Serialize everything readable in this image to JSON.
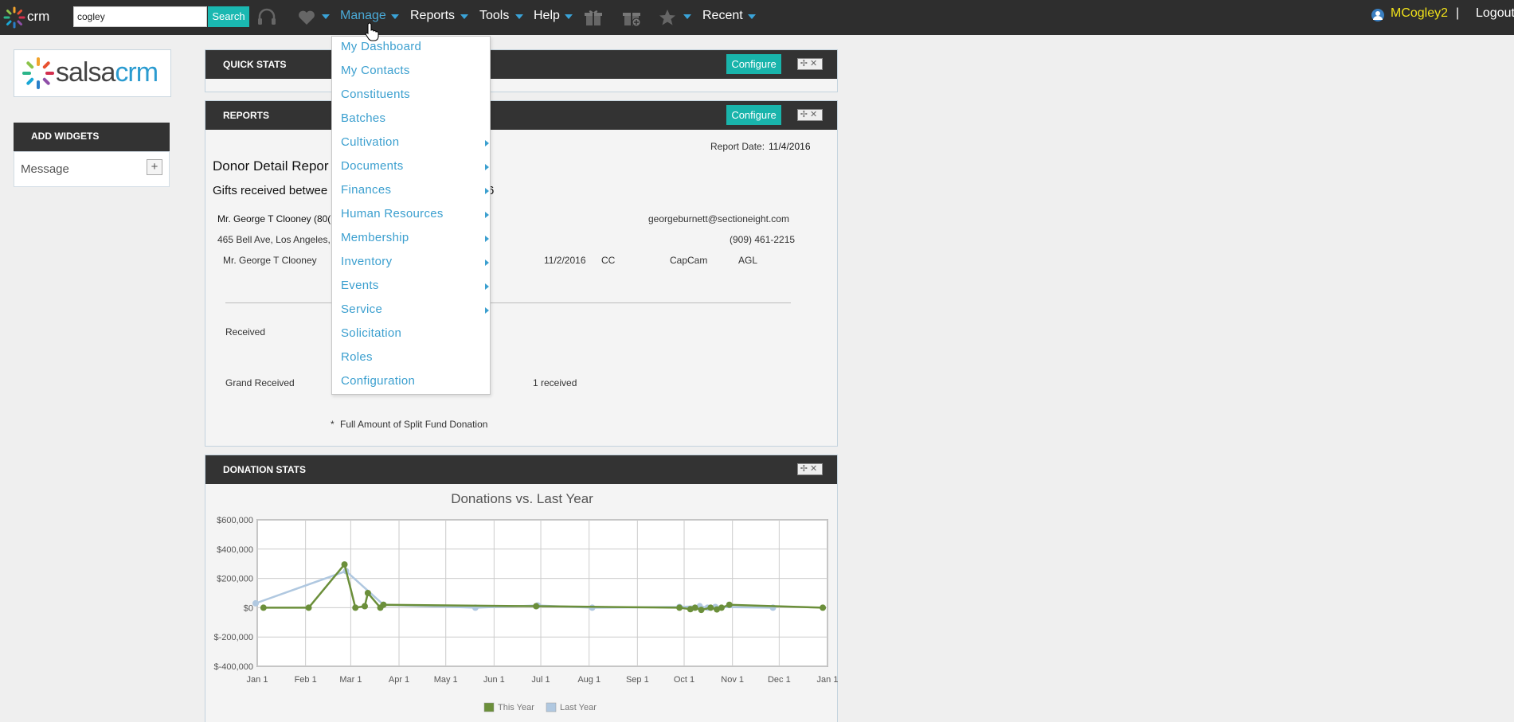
{
  "topbar": {
    "brand": "crm",
    "search": {
      "value": "cogley",
      "button": "Search"
    },
    "nav": [
      {
        "label": "Manage"
      },
      {
        "label": "Reports"
      },
      {
        "label": "Tools"
      },
      {
        "label": "Help"
      },
      {
        "label": "Recent"
      }
    ],
    "user": "MCogley2",
    "separator": "|",
    "logout": "Logout"
  },
  "sidebar": {
    "logo": {
      "salsa": "salsa",
      "crm": "crm"
    },
    "add_widgets": {
      "title": "ADD WIDGETS",
      "items": [
        {
          "label": "Message",
          "add": "+"
        }
      ]
    }
  },
  "panels": {
    "quick_stats": {
      "title": "QUICK STATS",
      "configure": "Configure"
    },
    "reports": {
      "title": "REPORTS",
      "configure": "Configure",
      "report_date_label": "Report Date:",
      "report_date": "11/4/2016",
      "heading": "Donor Detail Repor",
      "subheading": "Gifts received betwee",
      "subheading_tail": "6",
      "donor_name": "Mr. George T Clooney (80(",
      "email": "georgeburnett@sectioneight.com",
      "address": "465 Bell Ave, Los Angeles,",
      "phone": "(909) 461-2215",
      "row": {
        "name": "Mr. George T Clooney",
        "date": "11/2/2016",
        "type": "CC",
        "campaign": "CapCam",
        "fund": "AGL"
      },
      "received_label": "Received",
      "grand_received_label": "Grand Received",
      "grand_received_count": "1 received",
      "footnote_star": "*",
      "footnote": "Full Amount of Split Fund Donation"
    },
    "donation_stats": {
      "title": "DONATION STATS"
    }
  },
  "dropdown": {
    "items": [
      {
        "label": "My Dashboard",
        "submenu": false
      },
      {
        "label": "My Contacts",
        "submenu": false
      },
      {
        "label": "Constituents",
        "submenu": false
      },
      {
        "label": "Batches",
        "submenu": false
      },
      {
        "label": "Cultivation",
        "submenu": true
      },
      {
        "label": "Documents",
        "submenu": true
      },
      {
        "label": "Finances",
        "submenu": true
      },
      {
        "label": "Human Resources",
        "submenu": true
      },
      {
        "label": "Membership",
        "submenu": true
      },
      {
        "label": "Inventory",
        "submenu": true
      },
      {
        "label": "Events",
        "submenu": true
      },
      {
        "label": "Service",
        "submenu": true
      },
      {
        "label": "Solicitation",
        "submenu": false
      },
      {
        "label": "Roles",
        "submenu": false
      },
      {
        "label": "Configuration",
        "submenu": false
      }
    ]
  },
  "chart_data": {
    "type": "line",
    "title": "Donations vs. Last Year",
    "xlabel": "",
    "ylabel": "",
    "xlim": [
      "2016-01-01",
      "2017-01-01"
    ],
    "ylim": [
      -400000,
      600000
    ],
    "yticks": [
      "$600,000",
      "$400,000",
      "$200,000",
      "$0",
      "$-200,000",
      "$-400,000"
    ],
    "xticks": [
      "Jan 1",
      "Feb 1",
      "Mar 1",
      "Apr 1",
      "May 1",
      "Jun 1",
      "Jul 1",
      "Aug 1",
      "Sep 1",
      "Oct 1",
      "Nov 1",
      "Dec 1",
      "Jan 1"
    ],
    "grid": true,
    "legend": "bottom",
    "series": [
      {
        "name": "This Year",
        "color": "#6b8f3a",
        "points": [
          [
            "2016-01-05",
            0
          ],
          [
            "2016-02-03",
            0
          ],
          [
            "2016-02-26",
            295000
          ],
          [
            "2016-03-04",
            0
          ],
          [
            "2016-03-10",
            10000
          ],
          [
            "2016-03-12",
            100000
          ],
          [
            "2016-03-20",
            0
          ],
          [
            "2016-03-22",
            20000
          ],
          [
            "2016-06-28",
            10000
          ],
          [
            "2016-09-28",
            0
          ],
          [
            "2016-10-05",
            -10000
          ],
          [
            "2016-10-08",
            0
          ],
          [
            "2016-10-12",
            -15000
          ],
          [
            "2016-10-18",
            0
          ],
          [
            "2016-10-22",
            -12000
          ],
          [
            "2016-10-25",
            0
          ],
          [
            "2016-10-30",
            20000
          ],
          [
            "2016-12-29",
            0
          ]
        ]
      },
      {
        "name": "Last Year",
        "color": "#b0c8e0",
        "points": [
          [
            "2015-12-31",
            30000
          ],
          [
            "2016-02-27",
            250000
          ],
          [
            "2016-03-22",
            20000
          ],
          [
            "2016-05-20",
            0
          ],
          [
            "2016-06-29",
            15000
          ],
          [
            "2016-08-03",
            0
          ],
          [
            "2016-09-28",
            5000
          ],
          [
            "2016-10-11",
            10000
          ],
          [
            "2016-10-16",
            0
          ],
          [
            "2016-10-21",
            5000
          ],
          [
            "2016-11-27",
            0
          ]
        ]
      }
    ]
  }
}
